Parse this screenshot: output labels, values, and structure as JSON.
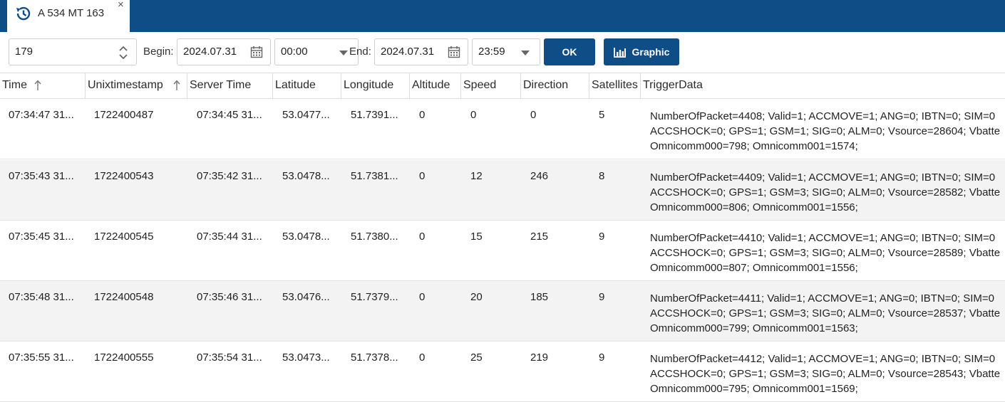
{
  "tab": {
    "title": "A 534 MT 163",
    "icon": "history-icon",
    "close": "×"
  },
  "toolbar": {
    "device_value": "179",
    "begin_label": "Begin:",
    "begin_date": "2024.07.31",
    "begin_time": "00:00",
    "end_label": "End:",
    "end_date": "2024.07.31",
    "end_time": "23:59",
    "ok_label": "OK",
    "graphic_label": "Graphic"
  },
  "colors": {
    "accent": "#0e4d85",
    "alt_row": "#f3f3f3"
  },
  "columns": [
    "Time",
    "Unixtimestamp",
    "Server Time",
    "Latitude",
    "Longitude",
    "Altitude",
    "Speed",
    "Direction",
    "Satellites",
    "TriggerData"
  ],
  "rows": [
    {
      "time": "07:34:47 31...",
      "unix": "1722400487",
      "server": "07:34:45 31...",
      "lat": "53.0477...",
      "lon": "51.7391...",
      "alt": "0",
      "speed": "0",
      "dir": "0",
      "sat": "5",
      "trigger": [
        "NumberOfPacket=4408; Valid=1; ACCMOVE=1; ANG=0; IBTN=0; SIM=0",
        "ACCSHOCK=0; GPS=1; GSM=1; SIG=0; ALM=0; Vsource=28604; Vbatte",
        "Omnicomm000=798; Omnicomm001=1574;"
      ]
    },
    {
      "time": "07:35:43 31...",
      "unix": "1722400543",
      "server": "07:35:42 31...",
      "lat": "53.0478...",
      "lon": "51.7381...",
      "alt": "0",
      "speed": "12",
      "dir": "246",
      "sat": "8",
      "trigger": [
        "NumberOfPacket=4409; Valid=1; ACCMOVE=1; ANG=0; IBTN=0; SIM=0",
        "ACCSHOCK=0; GPS=1; GSM=3; SIG=0; ALM=0; Vsource=28582; Vbatte",
        "Omnicomm000=806; Omnicomm001=1556;"
      ]
    },
    {
      "time": "07:35:45 31...",
      "unix": "1722400545",
      "server": "07:35:44 31...",
      "lat": "53.0478...",
      "lon": "51.7380...",
      "alt": "0",
      "speed": "15",
      "dir": "215",
      "sat": "9",
      "trigger": [
        "NumberOfPacket=4410; Valid=1; ACCMOVE=1; ANG=0; IBTN=0; SIM=0",
        "ACCSHOCK=0; GPS=1; GSM=3; SIG=0; ALM=0; Vsource=28589; Vbatte",
        "Omnicomm000=807; Omnicomm001=1556;"
      ]
    },
    {
      "time": "07:35:48 31...",
      "unix": "1722400548",
      "server": "07:35:46 31...",
      "lat": "53.0476...",
      "lon": "51.7379...",
      "alt": "0",
      "speed": "20",
      "dir": "185",
      "sat": "9",
      "trigger": [
        "NumberOfPacket=4411; Valid=1; ACCMOVE=1; ANG=0; IBTN=0; SIM=0",
        "ACCSHOCK=0; GPS=1; GSM=3; SIG=0; ALM=0; Vsource=28537; Vbatte",
        "Omnicomm000=799; Omnicomm001=1563;"
      ]
    },
    {
      "time": "07:35:55 31...",
      "unix": "1722400555",
      "server": "07:35:54 31...",
      "lat": "53.0473...",
      "lon": "51.7378...",
      "alt": "0",
      "speed": "25",
      "dir": "219",
      "sat": "9",
      "trigger": [
        "NumberOfPacket=4412; Valid=1; ACCMOVE=1; ANG=0; IBTN=0; SIM=0",
        "ACCSHOCK=0; GPS=1; GSM=3; SIG=0; ALM=0; Vsource=28543; Vbatte",
        "Omnicomm000=795; Omnicomm001=1569;"
      ]
    }
  ]
}
